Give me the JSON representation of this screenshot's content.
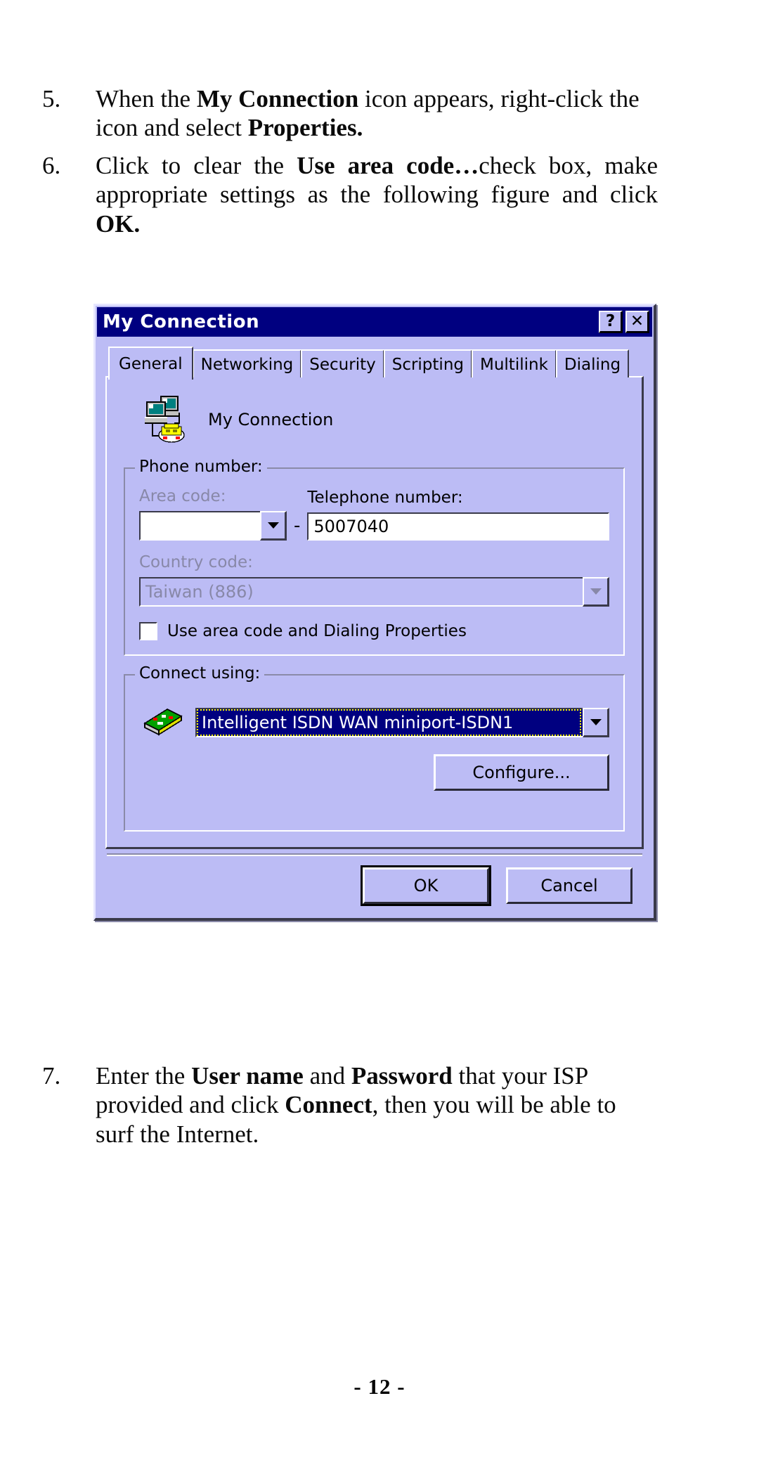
{
  "page": {
    "footer": "- 12 -"
  },
  "steps": [
    {
      "number": "5.",
      "parts": [
        {
          "t": "When the ",
          "b": false
        },
        {
          "t": "My Connection",
          "b": true
        },
        {
          "t": " icon appears, right-click the icon and select ",
          "b": false
        },
        {
          "t": "Properties.",
          "b": true
        }
      ]
    },
    {
      "number": "6.",
      "parts": [
        {
          "t": "Click to clear the ",
          "b": false
        },
        {
          "t": "Use area code…",
          "b": true
        },
        {
          "t": "check box, make appropriate settings as the following figure and click ",
          "b": false
        },
        {
          "t": "OK.",
          "b": true
        }
      ]
    },
    {
      "number": "7.",
      "parts": [
        {
          "t": "Enter the ",
          "b": false
        },
        {
          "t": "User name",
          "b": true
        },
        {
          "t": " and ",
          "b": false
        },
        {
          "t": "Password",
          "b": true
        },
        {
          "t": " that your ISP provided and click ",
          "b": false
        },
        {
          "t": "Connect",
          "b": true
        },
        {
          "t": ", then you will be able to surf the Internet.",
          "b": false
        }
      ]
    }
  ],
  "dialog": {
    "title": "My Connection",
    "titlebar_buttons": [
      {
        "label": "?",
        "name": "help-button"
      },
      {
        "label": "✕",
        "name": "close-button"
      }
    ],
    "tabs": [
      {
        "label": "General",
        "active": true
      },
      {
        "label": "Networking",
        "active": false
      },
      {
        "label": "Security",
        "active": false
      },
      {
        "label": "Scripting",
        "active": false
      },
      {
        "label": "Multilink",
        "active": false
      },
      {
        "label": "Dialing",
        "active": false
      }
    ],
    "connection": {
      "icon": "dialup-networking-icon",
      "name": "My Connection"
    },
    "phone_group": {
      "title": "Phone number:",
      "area_code_label": "Area code:",
      "area_code_value": "",
      "separator": "-",
      "telephone_label": "Telephone number:",
      "telephone_value": "5007040",
      "country_label": "Country code:",
      "country_value": "Taiwan (886)",
      "checkbox_label": "Use area code and Dialing Properties",
      "checkbox_checked": false
    },
    "connect_group": {
      "title": "Connect using:",
      "device_icon": "network-adapter-icon",
      "device_value": "Intelligent ISDN WAN miniport-ISDN1",
      "configure_label": "Configure..."
    },
    "footer_buttons": {
      "ok": "OK",
      "cancel": "Cancel"
    }
  },
  "colors": {
    "titlebar": "#000080",
    "dialog_face": "#bcbcf5",
    "selection": "#000080",
    "focus_outline": "#ffff00",
    "disabled_text": "#8888a8"
  }
}
